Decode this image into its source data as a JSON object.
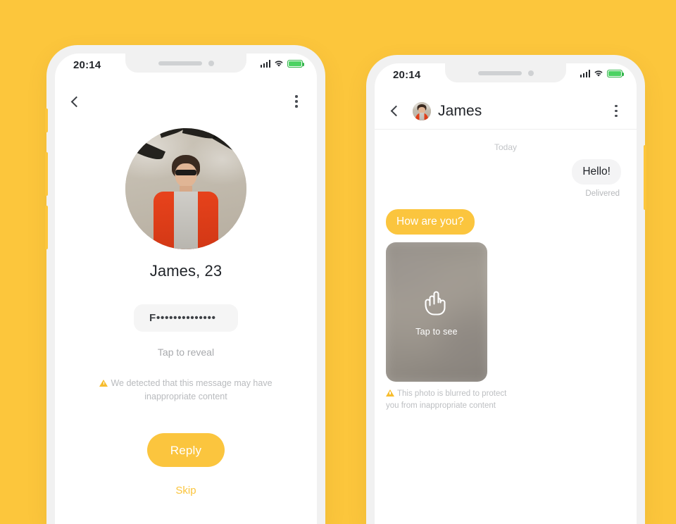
{
  "background_color": "#fcc63c",
  "accent_color": "#fbc53e",
  "phone_left": {
    "status_bar": {
      "time": "20:14",
      "signal_icon": "signal-bars-icon",
      "wifi_icon": "wifi-icon",
      "battery_icon": "battery-icon",
      "battery_color": "#4cd263"
    },
    "appbar": {
      "back_icon": "chevron-left-icon",
      "menu_icon": "kebab-menu-icon"
    },
    "profile": {
      "avatar_alt": "profile-photo-man-in-red-jacket",
      "name": "James, 23",
      "masked_message": "F••••••••••••••",
      "tap_to_reveal": "Tap to reveal",
      "warning_icon": "warning-triangle-icon",
      "warning_text": "We detected that this message may have inappropriate content",
      "reply_label": "Reply",
      "skip_label": "Skip"
    }
  },
  "phone_right": {
    "status_bar": {
      "time": "20:14",
      "signal_icon": "signal-bars-icon",
      "wifi_icon": "wifi-icon",
      "battery_icon": "battery-icon",
      "battery_color": "#4cd263"
    },
    "appbar": {
      "back_icon": "chevron-left-icon",
      "avatar_alt": "contact-avatar-james",
      "title": "James",
      "menu_icon": "kebab-menu-icon"
    },
    "chat": {
      "day_label": "Today",
      "messages": [
        {
          "text": "Hello!",
          "direction": "outgoing"
        },
        {
          "text": "How are you?",
          "direction": "incoming"
        }
      ],
      "delivered_status": "Delivered",
      "blurred_photo": {
        "tap_icon": "tap-hand-icon",
        "tap_label": "Tap to see"
      },
      "warning_icon": "warning-triangle-icon",
      "warning_text": "This photo is blurred to protect you from inappropriate content"
    }
  }
}
